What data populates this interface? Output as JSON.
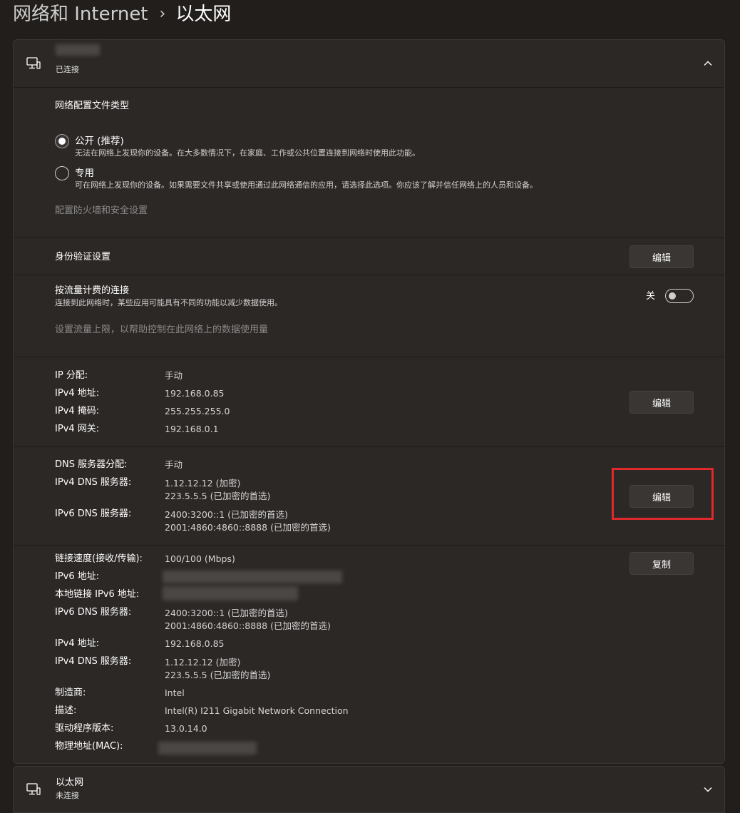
{
  "breadcrumb": {
    "parent": "网络和 Internet",
    "separator": "›",
    "current": "以太网"
  },
  "adapter": {
    "status": "已连接",
    "expanded_icon": "chevron-up-icon"
  },
  "profile": {
    "title": "网络配置文件类型",
    "public": {
      "label": "公开 (推荐)",
      "desc": "无法在网络上发现你的设备。在大多数情况下，在家庭、工作或公共位置连接到网络时使用此功能。",
      "selected": true
    },
    "private": {
      "label": "专用",
      "desc": "可在网络上发现你的设备。如果需要文件共享或使用通过此网络通信的应用，请选择此选项。你应该了解并信任网络上的人员和设备。",
      "selected": false
    },
    "firewall_link": "配置防火墙和安全设置"
  },
  "auth": {
    "label": "身份验证设置",
    "button": "编辑"
  },
  "metered": {
    "label": "按流量计费的连接",
    "desc": "连接到此网络时，某些应用可能具有不同的功能以减少数据使用。",
    "toggle_label": "关",
    "toggle_on": false,
    "data_limit_link": "设置流量上限，以帮助控制在此网络上的数据使用量"
  },
  "ip": {
    "button": "编辑",
    "rows": [
      {
        "key": "IP 分配:",
        "value": "手动"
      },
      {
        "key": "IPv4 地址:",
        "value": "192.168.0.85"
      },
      {
        "key": "IPv4 掩码:",
        "value": "255.255.255.0"
      },
      {
        "key": "IPv4 网关:",
        "value": "192.168.0.1"
      }
    ]
  },
  "dns": {
    "button": "编辑",
    "assign_key": "DNS 服务器分配:",
    "assign_value": "手动",
    "ipv4_key": "IPv4 DNS 服务器:",
    "ipv4_values": [
      "1.12.12.12 (加密)",
      "223.5.5.5 (已加密的首选)"
    ],
    "ipv6_key": "IPv6 DNS 服务器:",
    "ipv6_values": [
      "2400:3200::1 (已加密的首选)",
      "2001:4860:4860::8888 (已加密的首选)"
    ]
  },
  "properties": {
    "button": "复制",
    "link_speed_key": "链接速度(接收/传输):",
    "link_speed_value": "100/100 (Mbps)",
    "ipv6_addr_key": "IPv6 地址:",
    "link_local_key": "本地链接 IPv6 地址:",
    "ipv6_dns_key": "IPv6 DNS 服务器:",
    "ipv6_dns_values": [
      "2400:3200::1 (已加密的首选)",
      "2001:4860:4860::8888 (已加密的首选)"
    ],
    "ipv4_addr_key": "IPv4 地址:",
    "ipv4_addr_value": "192.168.0.85",
    "ipv4_dns_key": "IPv4 DNS 服务器:",
    "ipv4_dns_values": [
      "1.12.12.12 (加密)",
      "223.5.5.5 (已加密的首选)"
    ],
    "manufacturer_key": "制造商:",
    "manufacturer_value": "Intel",
    "description_key": "描述:",
    "description_value": "Intel(R) I211 Gigabit Network Connection",
    "driver_key": "驱动程序版本:",
    "driver_value": "13.0.14.0",
    "mac_key": "物理地址(MAC):"
  },
  "adapter2": {
    "name": "以太网",
    "status": "未连接",
    "expand_icon": "chevron-down-icon"
  },
  "colors": {
    "background": "#211e1c",
    "card": "#2c2826",
    "highlight": "#e0292c"
  }
}
